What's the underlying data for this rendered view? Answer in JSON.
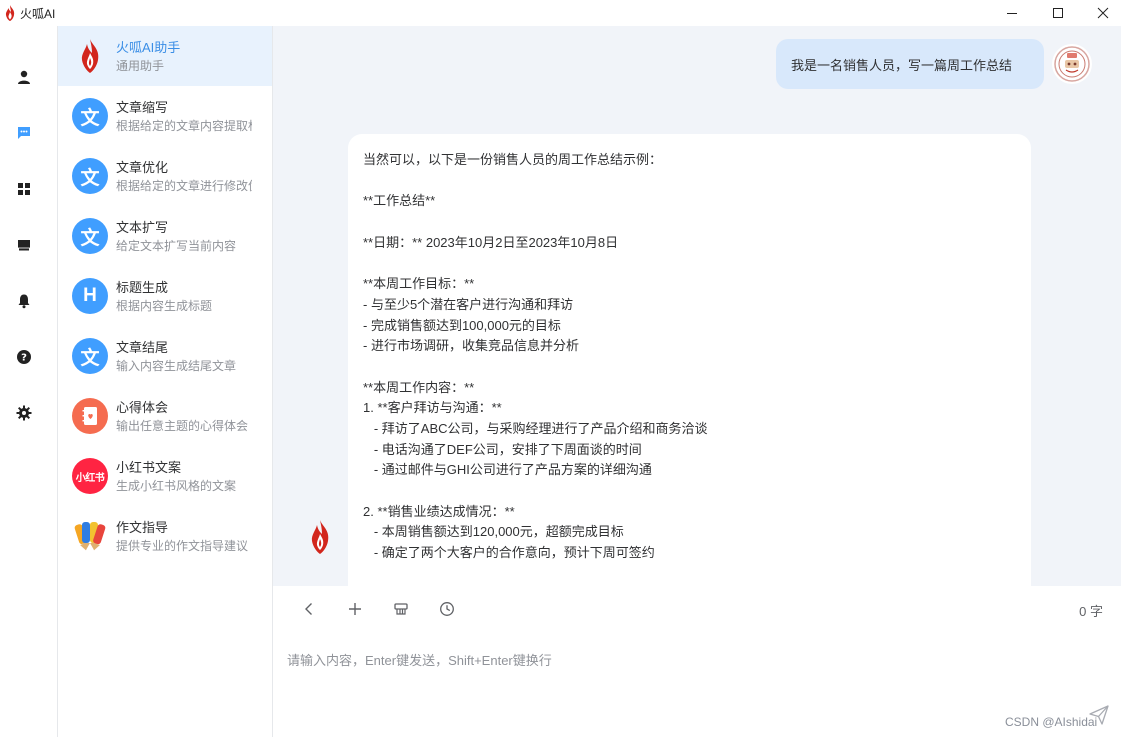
{
  "window": {
    "title": "火呱AI"
  },
  "rail": {
    "items": [
      {
        "icon": "user-icon"
      },
      {
        "icon": "chat-icon",
        "active": true
      },
      {
        "icon": "apps-icon"
      },
      {
        "icon": "store-icon"
      },
      {
        "icon": "bell-icon"
      },
      {
        "icon": "help-icon"
      },
      {
        "icon": "gear-icon"
      }
    ]
  },
  "assistants": [
    {
      "name": "火呱AI助手",
      "desc": "通用助手",
      "icon": "fire-logo-icon",
      "active": true
    },
    {
      "name": "文章缩写",
      "desc": "根据给定的文章内容提取标",
      "glyph": "文",
      "color": "#409eff"
    },
    {
      "name": "文章优化",
      "desc": "根据给定的文章进行修改优",
      "glyph": "文",
      "color": "#409eff"
    },
    {
      "name": "文本扩写",
      "desc": "给定文本扩写当前内容",
      "glyph": "文",
      "color": "#409eff"
    },
    {
      "name": "标题生成",
      "desc": "根据内容生成标题",
      "glyph": "H",
      "color": "#409eff"
    },
    {
      "name": "文章结尾",
      "desc": "输入内容生成结尾文章",
      "glyph": "文",
      "color": "#409eff"
    },
    {
      "name": "心得体会",
      "desc": "输出任意主题的心得体会",
      "glyph": "",
      "color": "#f56c50",
      "icon": "notebook-icon"
    },
    {
      "name": "小红书文案",
      "desc": "生成小红书风格的文案",
      "glyph": "小红书",
      "color": "#ff2442"
    },
    {
      "name": "作文指导",
      "desc": "提供专业的作文指导建议",
      "icon": "pencils-icon"
    }
  ],
  "chat": {
    "user_message": "我是一名销售人员，写一篇周工作总结",
    "bot_lines": [
      "当然可以，以下是一份销售人员的周工作总结示例：",
      "",
      "**工作总结**",
      "",
      "**日期：** 2023年10月2日至2023年10月8日",
      "",
      "**本周工作目标：**",
      "- 与至少5个潜在客户进行沟通和拜访",
      "- 完成销售额达到100,000元的目标",
      "- 进行市场调研，收集竞品信息并分析",
      "",
      "**本周工作内容：**",
      "1. **客户拜访与沟通：**",
      "   - 拜访了ABC公司，与采购经理进行了产品介绍和商务洽谈",
      "   - 电话沟通了DEF公司，安排了下周面谈的时间",
      "   - 通过邮件与GHI公司进行了产品方案的详细沟通",
      "",
      "2. **销售业绩达成情况：**",
      "   - 本周销售额达到120,000元，超额完成目标",
      "   - 确定了两个大客户的合作意向，预计下周可签约"
    ]
  },
  "composer": {
    "word_count": "0 字",
    "placeholder": "请输入内容，Enter键发送，Shift+Enter键换行",
    "value": "",
    "tools": [
      "back-icon",
      "plus-icon",
      "clear-icon",
      "history-icon"
    ]
  },
  "watermark": "CSDN @AIshidai"
}
